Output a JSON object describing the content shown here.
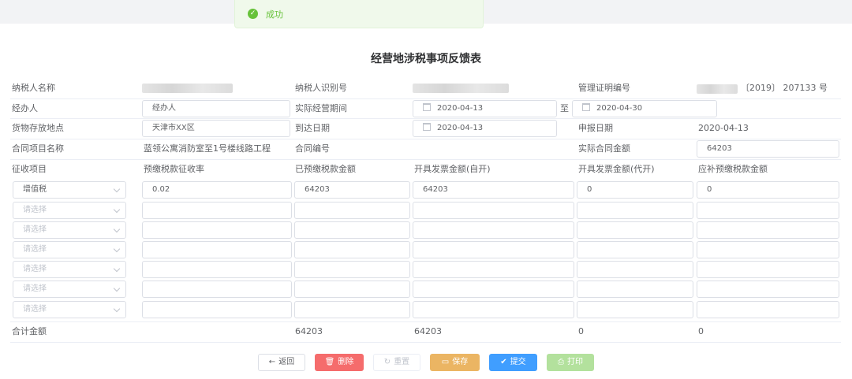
{
  "toast": {
    "icon": "check-circle-icon",
    "message": "成功"
  },
  "title": "经营地涉税事项反馈表",
  "row1": {
    "taxpayer_name_label": "纳税人名称",
    "taxpayer_id_label": "纳税人识别号",
    "certificate_no_label": "管理证明编号",
    "certificate_no_suffix": "〔2019〕 207133 号"
  },
  "row2": {
    "handler_label": "经办人",
    "handler_value": "经办人",
    "period_label": "实际经营期间",
    "period_start": "2020-04-13",
    "period_to": "至",
    "period_end": "2020-04-30"
  },
  "row3": {
    "location_label": "货物存放地点",
    "location_value": "天津市XX区",
    "arrival_label": "到达日期",
    "arrival_date": "2020-04-13",
    "declare_label": "申报日期",
    "declare_date": "2020-04-13"
  },
  "row4": {
    "project_label": "合同项目名称",
    "project_value": "蓝领公寓消防室至1号楼线路工程",
    "contract_no_label": "合同编号",
    "contract_amount_label": "实际合同金额",
    "contract_amount_value": "64203"
  },
  "tax_table": {
    "headers": [
      "征收项目",
      "预缴税款征收率",
      "已预缴税款金额",
      "开具发票金额(自开)",
      "开具发票金额(代开)",
      "应补预缴税款金额"
    ],
    "first_row": {
      "item": "增值税",
      "rate": "0.02",
      "prepaid": "64203",
      "self_issued": "64203",
      "agent_issued": "0",
      "supplement": "0"
    },
    "placeholder": "请选择",
    "total": {
      "label": "合计金额",
      "prepaid": "64203",
      "self_issued": "64203",
      "agent_issued": "0",
      "supplement": "0"
    }
  },
  "buttons": {
    "back": "返回",
    "delete": "删除",
    "reset": "重置",
    "save": "保存",
    "submit": "提交",
    "print": "打印"
  },
  "colors": {
    "success": "#67c23a",
    "danger": "#f56c6c",
    "warning": "#e6a23c",
    "primary": "#409eff",
    "border": "#dcdfe6"
  }
}
